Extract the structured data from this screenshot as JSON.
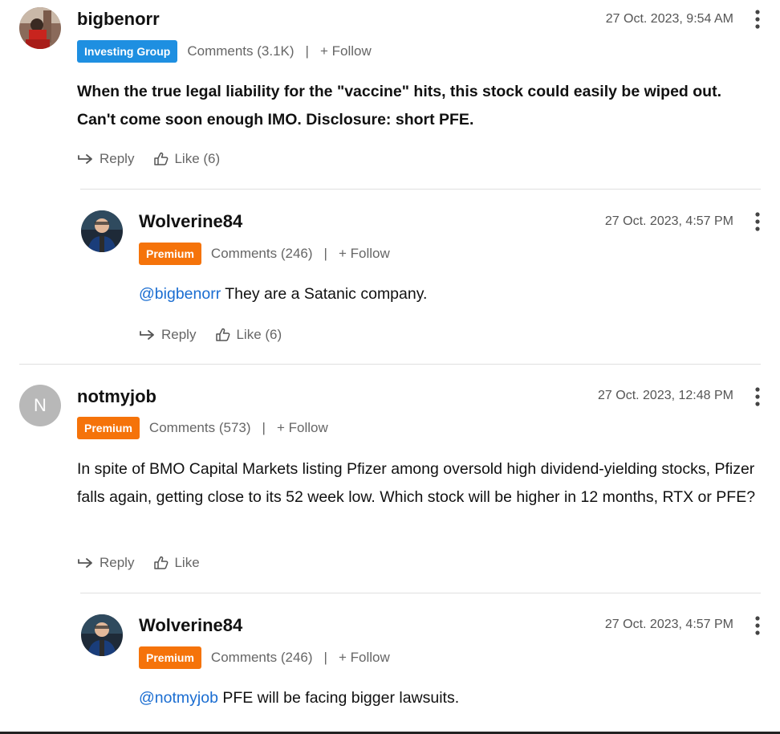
{
  "comments": [
    {
      "username": "bigbenorr",
      "timestamp": "27 Oct. 2023, 9:54 AM",
      "badge": "Investing Group",
      "comments_count": "Comments (3.1K)",
      "separator": "|",
      "follow": "+ Follow",
      "body": "When the true legal liability for the \"vaccine\" hits, this stock could easily be wiped out. Can't come soon enough IMO. Disclosure: short PFE.",
      "reply": "Reply",
      "like": "Like (6)"
    },
    {
      "username": "Wolverine84",
      "timestamp": "27 Oct. 2023, 4:57 PM",
      "badge": "Premium",
      "comments_count": "Comments (246)",
      "separator": "|",
      "follow": "+ Follow",
      "mention": "@bigbenorr",
      "body": " They are a Satanic company.",
      "reply": "Reply",
      "like": "Like (6)"
    },
    {
      "username": "notmyjob",
      "avatar_initial": "N",
      "timestamp": "27 Oct. 2023, 12:48 PM",
      "badge": "Premium",
      "comments_count": "Comments (573)",
      "separator": "|",
      "follow": "+ Follow",
      "body": "In spite of BMO Capital Markets listing Pfizer among oversold high dividend-yielding stocks, Pfizer falls again, getting close to its 52 week low. Which stock will be higher in 12 months, RTX or PFE?",
      "reply": "Reply",
      "like": "Like"
    },
    {
      "username": "Wolverine84",
      "timestamp": "27 Oct. 2023, 4:57 PM",
      "badge": "Premium",
      "comments_count": "Comments (246)",
      "separator": "|",
      "follow": "+ Follow",
      "mention": "@notmyjob",
      "body": " PFE will be facing bigger lawsuits."
    }
  ],
  "colors": {
    "investing_badge": "#1e8fe1",
    "premium_badge": "#f5730a",
    "mention": "#1a6dd1"
  },
  "icons": [
    "reply-arrow-icon",
    "thumbs-up-icon",
    "more-vertical-icon"
  ]
}
